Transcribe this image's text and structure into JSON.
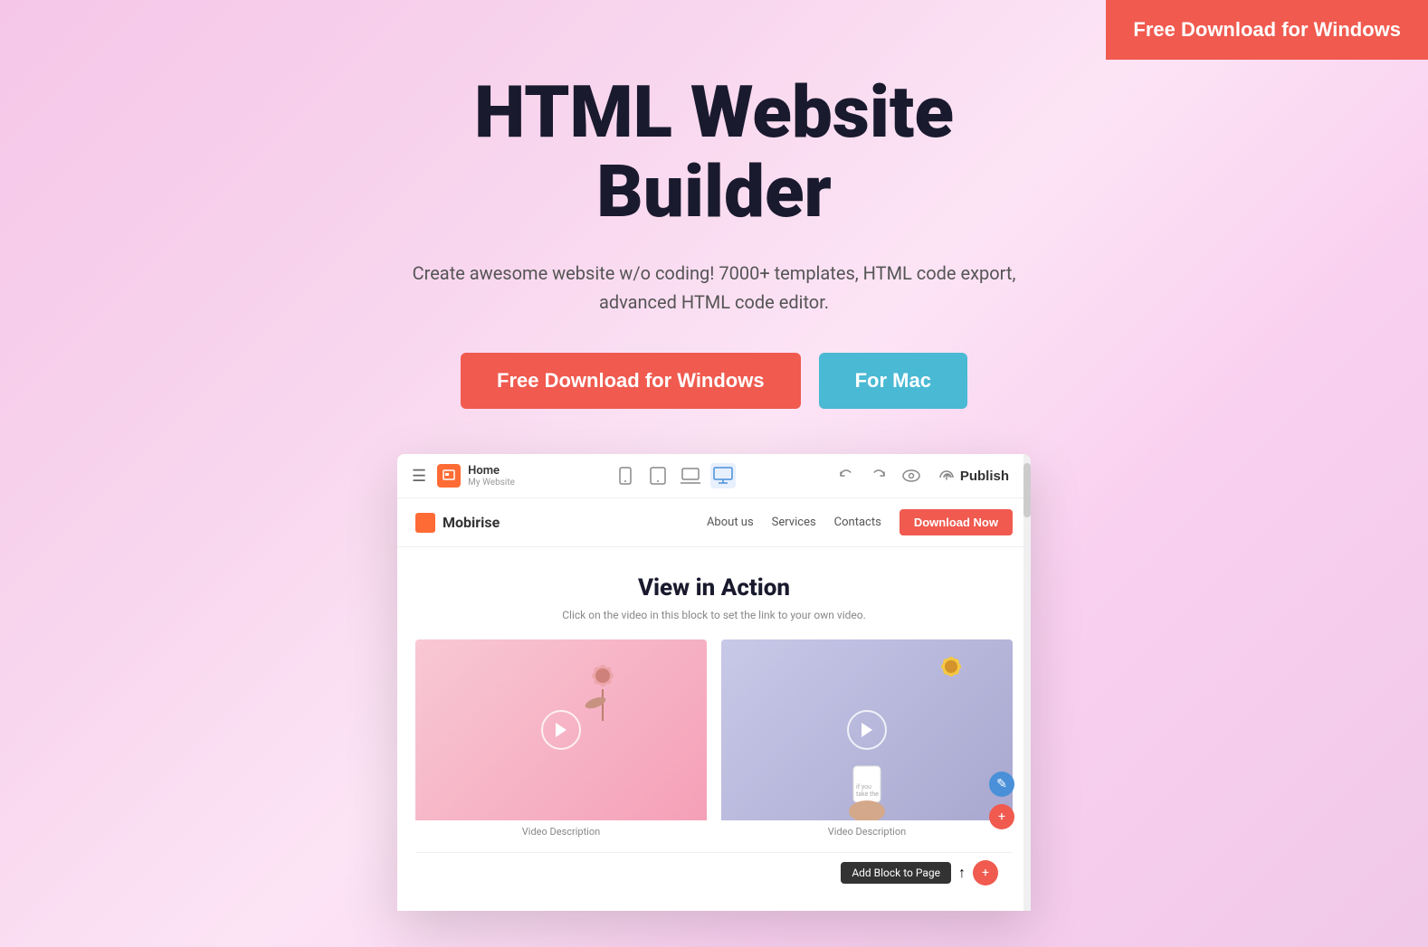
{
  "topButton": {
    "label": "Free Download for Windows"
  },
  "hero": {
    "title": "HTML Website Builder",
    "subtitle": "Create awesome website w/o coding! 7000+ templates, HTML code export, advanced HTML code editor.",
    "ctaWindows": "Free Download for Windows",
    "ctaMac": "For Mac"
  },
  "appMockup": {
    "toolbar": {
      "menuIcon": "☰",
      "homeLabel": "Home",
      "homeSublabel": "My Website",
      "deviceMobile": "📱",
      "deviceTablet": "⬜",
      "deviceLaptop": "⬜",
      "deviceDesktop": "🖥",
      "undoIcon": "↩",
      "redoIcon": "↪",
      "previewIcon": "👁",
      "publishLabel": "Publish",
      "cloudIcon": "☁"
    },
    "innerNav": {
      "logoText": "Mobirise",
      "links": [
        "About us",
        "Services",
        "Contacts"
      ],
      "downloadBtn": "Download Now"
    },
    "innerContent": {
      "title": "View in Action",
      "subtitle": "Click on the video in this block to set the link to your own video.",
      "video1Desc": "Video Description",
      "video2Desc": "Video Description",
      "addBlockLabel": "Add Block to Page"
    }
  }
}
